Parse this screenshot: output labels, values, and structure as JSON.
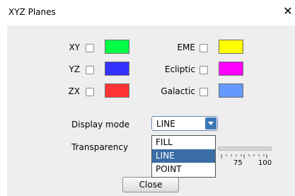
{
  "window": {
    "title": "XYZ Planes",
    "close_glyph": "✕"
  },
  "planes_left": [
    {
      "label": "XY",
      "color": "#00ff44"
    },
    {
      "label": "YZ",
      "color": "#3333ff"
    },
    {
      "label": "ZX",
      "color": "#ff3333"
    }
  ],
  "planes_right": [
    {
      "label": "EME",
      "color": "#ffff00"
    },
    {
      "label": "Ecliptic",
      "color": "#ff00ff"
    },
    {
      "label": "Galactic",
      "color": "#6699ff"
    }
  ],
  "display_mode": {
    "label": "Display mode",
    "value": "LINE",
    "options": [
      "FILL",
      "LINE",
      "POINT"
    ],
    "highlighted": "LINE"
  },
  "transparency": {
    "label": "Transparency",
    "tick_labels": [
      "75",
      "100"
    ]
  },
  "close_button": {
    "label": "Close"
  },
  "colors": {
    "accent": "#3a6ea5",
    "panel_bg": "#eeeeee"
  }
}
